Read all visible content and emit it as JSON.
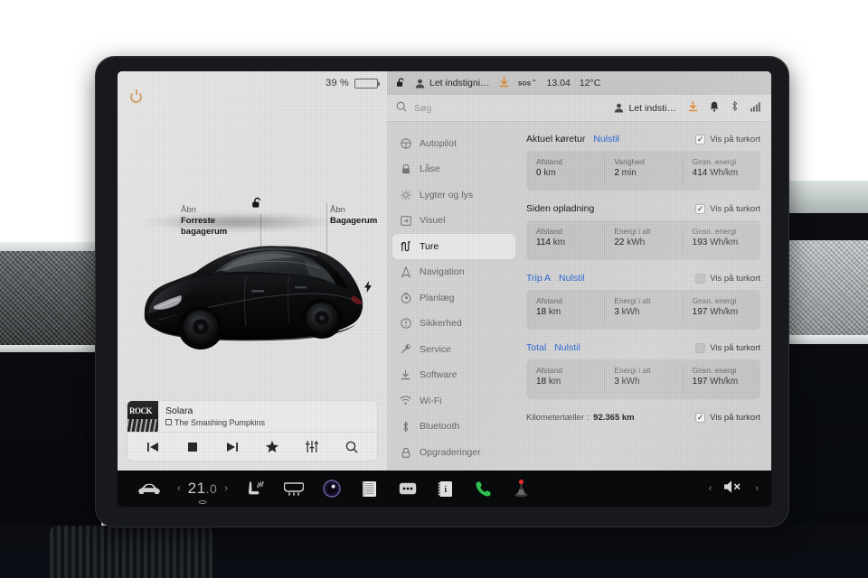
{
  "left_panel": {
    "battery_percent": "39 %",
    "battery_level": 39,
    "power_icon": "power-icon",
    "front_trunk": {
      "action": "Åbn",
      "target": "Forreste bagagerum"
    },
    "rear_trunk": {
      "action": "Åbn",
      "target": "Bagagerum"
    },
    "charge_port_icon": "charge-bolt-icon",
    "lock_icon": "unlocked-padlock-icon",
    "vehicle": "tesla-model-3-black"
  },
  "media": {
    "title": "Solara",
    "artist": "The Smashing Pumpkins",
    "album_art_text": "ROCK",
    "controls": [
      {
        "name": "previous-track-button",
        "glyph": "⏮"
      },
      {
        "name": "stop-button",
        "glyph": "■"
      },
      {
        "name": "next-track-button",
        "glyph": "⏭"
      },
      {
        "name": "favorite-button",
        "glyph": "★"
      },
      {
        "name": "equalizer-button",
        "glyph": "sliders"
      },
      {
        "name": "search-media-button",
        "glyph": "search"
      }
    ]
  },
  "status_bar": {
    "lock_icon": "unlocked-padlock-icon",
    "profile": "Let indstigni…",
    "download_icon": "software-download-icon",
    "sos": "SOS",
    "time": "13.04",
    "temperature": "12°C"
  },
  "search": {
    "placeholder": "Søg",
    "profile": "Let indsti…",
    "icons": [
      "software-download-icon",
      "notifications-bell-icon",
      "bluetooth-icon",
      "cellular-signal-icon"
    ]
  },
  "menu": {
    "items": [
      {
        "label": "Autopilot",
        "icon": "steering-wheel-icon",
        "selected": false
      },
      {
        "label": "Låse",
        "icon": "padlock-icon",
        "selected": false
      },
      {
        "label": "Lygter og lys",
        "icon": "headlight-icon",
        "selected": false
      },
      {
        "label": "Visuel",
        "icon": "display-icon",
        "selected": false
      },
      {
        "label": "Ture",
        "icon": "trips-icon",
        "selected": true
      },
      {
        "label": "Navigation",
        "icon": "navigation-arrow-icon",
        "selected": false
      },
      {
        "label": "Planlæg",
        "icon": "schedule-clock-icon",
        "selected": false
      },
      {
        "label": "Sikkerhed",
        "icon": "safety-warning-icon",
        "selected": false
      },
      {
        "label": "Service",
        "icon": "wrench-icon",
        "selected": false
      },
      {
        "label": "Software",
        "icon": "software-download-icon",
        "selected": false
      },
      {
        "label": "Wi-Fi",
        "icon": "wifi-icon",
        "selected": false
      },
      {
        "label": "Bluetooth",
        "icon": "bluetooth-icon",
        "selected": false
      },
      {
        "label": "Opgraderinger",
        "icon": "upgrade-lock-icon",
        "selected": false
      }
    ]
  },
  "trips": {
    "reset_label": "Nulstil",
    "show_on_map_label": "Vis på turkort",
    "sections": [
      {
        "name": "Aktuel køretur",
        "name_is_link": false,
        "has_reset": true,
        "show_on_map": true,
        "cells": [
          {
            "label": "Afstand",
            "value": "0",
            "unit": "km"
          },
          {
            "label": "Varighed",
            "value": "2",
            "unit": "min"
          },
          {
            "label": "Gnsn. energi",
            "value": "414",
            "unit": "Wh/km"
          }
        ]
      },
      {
        "name": "Siden opladning",
        "name_is_link": false,
        "has_reset": false,
        "show_on_map": true,
        "cells": [
          {
            "label": "Afstand",
            "value": "114",
            "unit": "km"
          },
          {
            "label": "Energi i alt",
            "value": "22",
            "unit": "kWh"
          },
          {
            "label": "Gnsn. energi",
            "value": "193",
            "unit": "Wh/km"
          }
        ]
      },
      {
        "name": "Trip A",
        "name_is_link": true,
        "has_reset": true,
        "show_on_map": false,
        "cells": [
          {
            "label": "Afstand",
            "value": "18",
            "unit": "km"
          },
          {
            "label": "Energi i alt",
            "value": "3",
            "unit": "kWh"
          },
          {
            "label": "Gnsn. energi",
            "value": "197",
            "unit": "Wh/km"
          }
        ]
      },
      {
        "name": "Total",
        "name_is_link": true,
        "has_reset": true,
        "show_on_map": false,
        "cells": [
          {
            "label": "Afstand",
            "value": "18",
            "unit": "km"
          },
          {
            "label": "Energi i alt",
            "value": "3",
            "unit": "kWh"
          },
          {
            "label": "Gnsn. energi",
            "value": "197",
            "unit": "Wh/km"
          }
        ]
      }
    ],
    "odometer": {
      "label": "Kilometertæller :",
      "value": "92.365 km",
      "show_on_map": true
    }
  },
  "taskbar": {
    "car_icon": "car-controls-icon",
    "temperature": "21.0",
    "temp_whole": "21",
    "temp_decimal": ".0",
    "left_chevron": "‹",
    "right_chevron": "›",
    "icons": [
      {
        "name": "seat-heater-icon"
      },
      {
        "name": "defroster-icon"
      },
      {
        "name": "camera-icon"
      },
      {
        "name": "calendar-icon"
      },
      {
        "name": "more-options-icon"
      },
      {
        "name": "contacts-icon"
      },
      {
        "name": "phone-icon"
      },
      {
        "name": "arcade-joystick-icon"
      }
    ],
    "volume": {
      "mute_icon": "volume-mute-icon",
      "prev": "‹",
      "next": "›"
    }
  },
  "colors": {
    "accent_blue": "#2f6bd8",
    "screen_bg": "#d8d8d8",
    "left_panel_bg": "#e8e8e8",
    "taskbar_bg": "#080a0c",
    "phone_green": "#2fbf4f",
    "download_orange": "#e8892a"
  }
}
